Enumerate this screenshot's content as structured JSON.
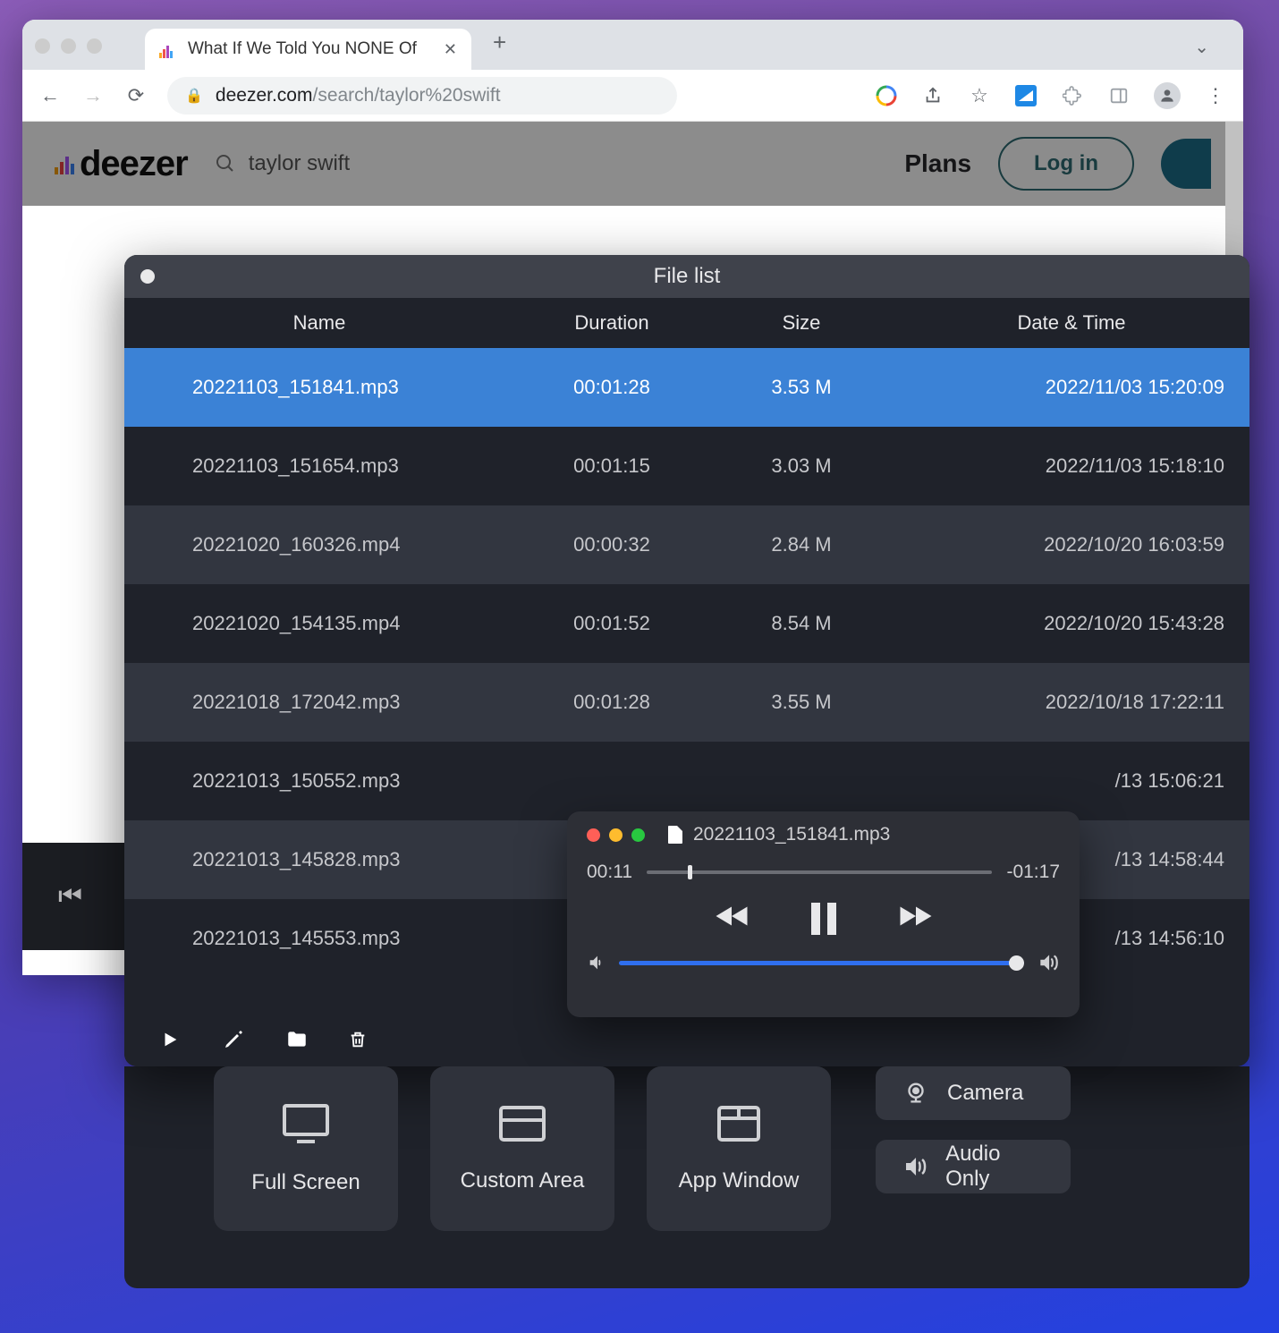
{
  "browser": {
    "tab_title": "What If We Told You NONE Of",
    "url_host": "deezer.com",
    "url_path": "/search/taylor%20swift"
  },
  "deezer": {
    "logo": "deezer",
    "search_value": "taylor swift",
    "plans": "Plans",
    "login": "Log in"
  },
  "filelist": {
    "title": "File list",
    "columns": {
      "name": "Name",
      "duration": "Duration",
      "size": "Size",
      "date": "Date & Time"
    },
    "rows": [
      {
        "name": "20221103_151841.mp3",
        "duration": "00:01:28",
        "size": "3.53 M",
        "date": "2022/11/03 15:20:09",
        "selected": true
      },
      {
        "name": "20221103_151654.mp3",
        "duration": "00:01:15",
        "size": "3.03 M",
        "date": "2022/11/03 15:18:10"
      },
      {
        "name": "20221020_160326.mp4",
        "duration": "00:00:32",
        "size": "2.84 M",
        "date": "2022/10/20 16:03:59"
      },
      {
        "name": "20221020_154135.mp4",
        "duration": "00:01:52",
        "size": "8.54 M",
        "date": "2022/10/20 15:43:28"
      },
      {
        "name": "20221018_172042.mp3",
        "duration": "00:01:28",
        "size": "3.55 M",
        "date": "2022/10/18 17:22:11"
      },
      {
        "name": "20221013_150552.mp3",
        "duration": "",
        "size": "",
        "date": "/13 15:06:21"
      },
      {
        "name": "20221013_145828.mp3",
        "duration": "",
        "size": "",
        "date": "/13 14:58:44"
      },
      {
        "name": "20221013_145553.mp3",
        "duration": "",
        "size": "",
        "date": "/13 14:56:10"
      }
    ]
  },
  "player": {
    "file": "20221103_151841.mp3",
    "elapsed": "00:11",
    "remaining": "-01:17"
  },
  "recorder": {
    "full_screen": "Full Screen",
    "custom_area": "Custom Area",
    "app_window": "App Window",
    "camera": "Camera",
    "audio_only": "Audio Only"
  }
}
